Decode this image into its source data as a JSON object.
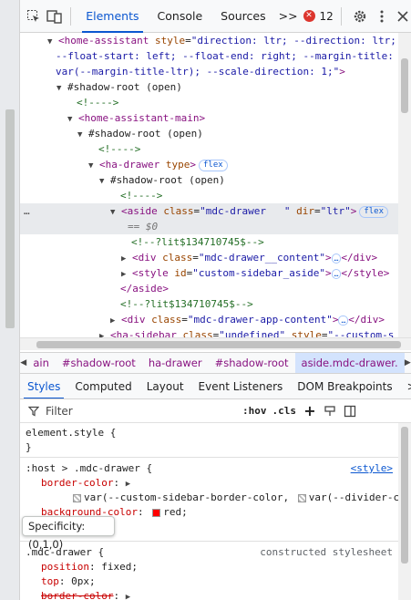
{
  "toolbar": {
    "tabs": [
      {
        "label": "Elements",
        "active": true
      },
      {
        "label": "Console",
        "active": false
      },
      {
        "label": "Sources",
        "active": false
      }
    ],
    "more_tabs_label": ">>",
    "error_count": "12",
    "icons": [
      "inspect-element-icon",
      "device-toolbar-icon",
      "settings-gear-icon",
      "more-options-icon",
      "close-icon"
    ]
  },
  "dom_tree": {
    "line1": {
      "tag_open": "<home-assistant",
      "attr_name": "style",
      "attr_val": "\"direction: ltr; --direction: ltr;"
    },
    "line2": {
      "text": "--float-start: left; --float-end: right; --margin-title:"
    },
    "line3": {
      "text": "var(--margin-title-ltr); --scale-direction: 1;\"",
      "close": ">"
    },
    "line4": {
      "text": "#shadow-root (open)"
    },
    "line5": {
      "text": "<!---->"
    },
    "line6": {
      "text": "<home-assistant-main>"
    },
    "line7": {
      "text": "#shadow-root (open)"
    },
    "line8": {
      "text": "<!---->"
    },
    "line9": {
      "tag_open": "<ha-drawer",
      "attr_name": "type",
      "close": ">",
      "badge": "flex"
    },
    "line10": {
      "text": "#shadow-root (open)"
    },
    "line11": {
      "text": "<!---->"
    },
    "line12": {
      "tag_open": "<aside",
      "attr1_name": "class",
      "attr1_val": "\"mdc-drawer   \"",
      "attr2_name": "dir",
      "attr2_val": "\"ltr\"",
      "close": ">",
      "badge": "flex",
      "dots": "…"
    },
    "line13": {
      "text": "== $0"
    },
    "line14": {
      "text": "<!--?lit$134710745$-->"
    },
    "line15": {
      "tag_open": "<div",
      "attr_name": "class",
      "attr_val": "\"mdc-drawer__content\"",
      "close": ">",
      "ellipsis": "…",
      "end_tag": "</div>"
    },
    "line16": {
      "tag_open": "<style",
      "attr_name": "id",
      "attr_val": "\"custom-sidebar_aside\"",
      "close": ">",
      "ellipsis": "…",
      "end_tag": "</style>"
    },
    "line17": {
      "text": "</aside>"
    },
    "line18": {
      "text": "<!--?lit$134710745$-->"
    },
    "line19": {
      "tag_open": "<div",
      "attr_name": "class",
      "attr_val": "\"mdc-drawer-app-content\"",
      "close": ">",
      "ellipsis": "…",
      "end_tag": "</div>"
    },
    "line20": {
      "tag_open": "<ha-sidebar",
      "attr1_name": "class",
      "attr1_val": "\"undefined\"",
      "attr2_name": "style",
      "attr2_val": "\"--custom-s"
    }
  },
  "breadcrumbs": [
    "ain",
    "#shadow-root",
    "ha-drawer",
    "#shadow-root",
    "aside.mdc-drawer."
  ],
  "styles_tabs": [
    {
      "label": "Styles",
      "active": true
    },
    {
      "label": "Computed",
      "active": false
    },
    {
      "label": "Layout",
      "active": false
    },
    {
      "label": "Event Listeners",
      "active": false
    },
    {
      "label": "DOM Breakpoints",
      "active": false
    }
  ],
  "styles_more": ">>",
  "filter": {
    "placeholder": "Filter",
    "hov_label": ":hov",
    "cls_label": ".cls",
    "add_label": "+"
  },
  "styles_rules": {
    "element_style": {
      "selector": "element.style {",
      "close": "}"
    },
    "host_rule": {
      "selector": ":host > .mdc-drawer {",
      "source": "<style>",
      "prop1_name": "border-color",
      "prop1_val_a": "var(--custom-sidebar-border-color,",
      "prop1_val_b": "var(--divider-co",
      "prop2_name": "background-color",
      "prop2_val": "red;",
      "close": "}"
    },
    "mdc_rule": {
      "selector": ".mdc-drawer {",
      "source": "constructed stylesheet",
      "prop1_name": "position",
      "prop1_val": "fixed;",
      "prop2_name": "top",
      "prop2_val": "0px;",
      "prop3_name": "border-color"
    }
  },
  "tooltip": {
    "text": "Specificity: (0,1,0)"
  },
  "colors": {
    "accent": "#0b57d0",
    "tag": "#881280",
    "attr_name": "#994500",
    "attr_value": "#1a1aa6",
    "comment": "#236e25",
    "property": "#c80000",
    "error": "#dc362e",
    "swatch_red": "#ff0000"
  }
}
